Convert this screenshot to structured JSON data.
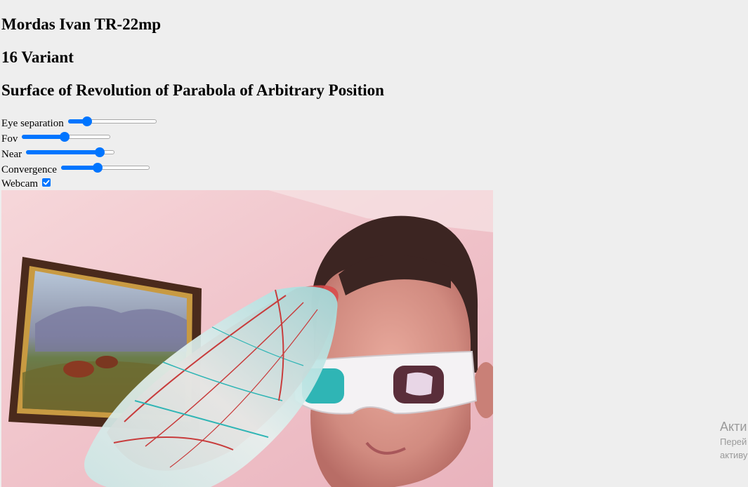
{
  "header": {
    "author": "Mordas Ivan TR-22mp",
    "variant": "16 Variant",
    "title": "Surface of Revolution of Parabola of Arbitrary Position"
  },
  "controls": {
    "eye_separation": {
      "label": "Eye separation",
      "value": 0.22
    },
    "fov": {
      "label": "Fov",
      "value": 0.48
    },
    "near": {
      "label": "Near",
      "value": 0.83
    },
    "convergence": {
      "label": "Convergence",
      "value": 0.41
    },
    "webcam": {
      "label": "Webcam",
      "checked": true
    }
  },
  "watermark": {
    "line1": "Акти",
    "line2": "Перей",
    "line3": "активу"
  },
  "colors": {
    "accent": "#0075ff",
    "background": "#eeeeee"
  }
}
